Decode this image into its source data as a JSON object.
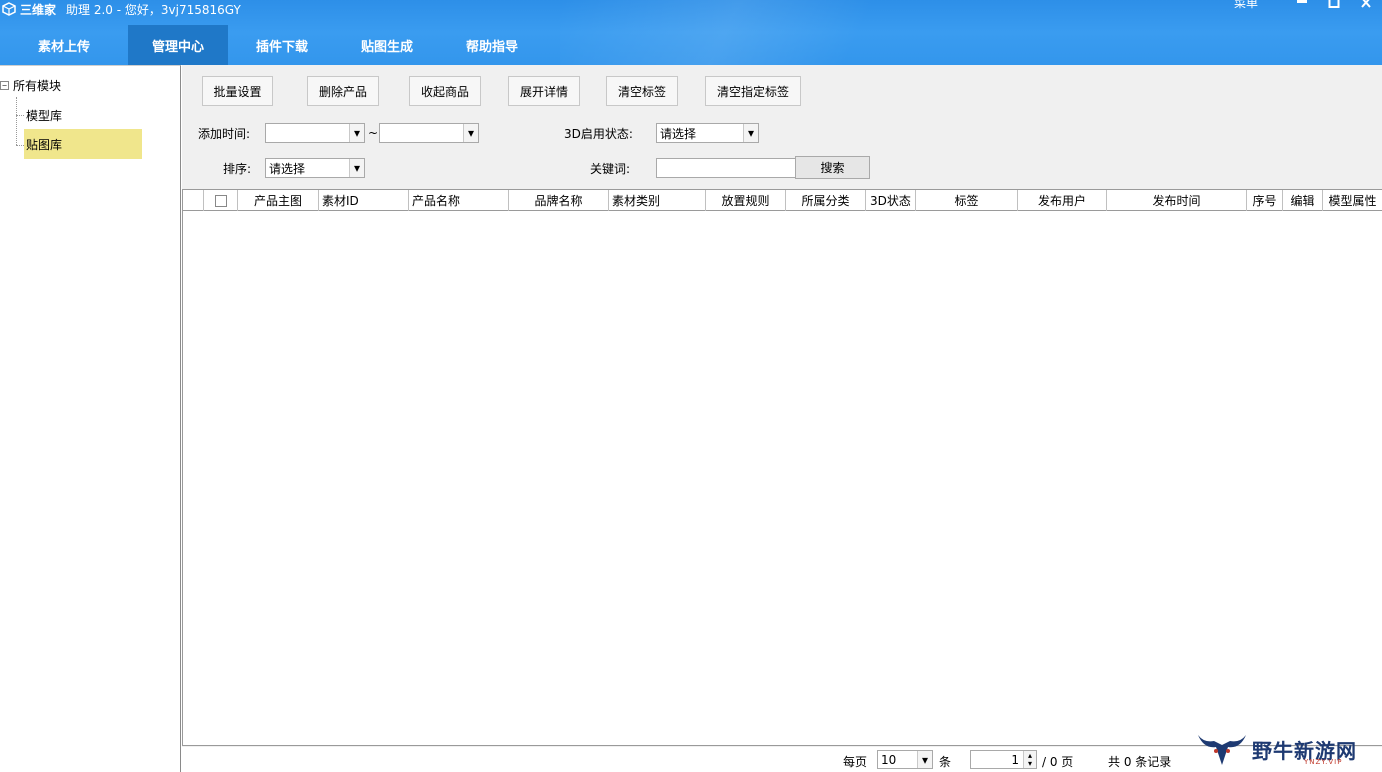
{
  "window": {
    "app_name": "三维家",
    "subtitle": "助理 2.0 - 您好，3vj715816GY",
    "menu_label": "菜单",
    "min_glyph": "▁",
    "max_glyph": "□",
    "close_glyph": "✕"
  },
  "tabs": [
    {
      "label": "素材上传"
    },
    {
      "label": "管理中心",
      "active": true
    },
    {
      "label": "插件下载"
    },
    {
      "label": "贴图生成"
    },
    {
      "label": "帮助指导"
    }
  ],
  "tree": {
    "toggle_glyph": "−",
    "root_label": "所有模块",
    "items": [
      {
        "label": "模型库"
      },
      {
        "label": "贴图库",
        "selected": true
      }
    ]
  },
  "toolbar": {
    "buttons": [
      {
        "label": "批量设置"
      },
      {
        "label": "删除产品"
      },
      {
        "label": "收起商品"
      },
      {
        "label": "展开详情"
      },
      {
        "label": "清空标签"
      },
      {
        "label": "清空指定标签"
      }
    ]
  },
  "filters": {
    "add_time_label": "添加时间:",
    "range_sep": "~",
    "date_from": "",
    "date_to": "",
    "state3d_label": "3D启用状态:",
    "state3d_value": "请选择",
    "sort_label": "排序:",
    "sort_value": "请选择",
    "keyword_label": "关键词:",
    "keyword_value": "",
    "search_label": "搜索",
    "dropdown_glyph": "▾"
  },
  "grid": {
    "columns": [
      {
        "label": ""
      },
      {
        "label": ""
      },
      {
        "label": "产品主图"
      },
      {
        "label": "素材ID"
      },
      {
        "label": "产品名称"
      },
      {
        "label": "品牌名称"
      },
      {
        "label": "素材类别"
      },
      {
        "label": "放置规则"
      },
      {
        "label": "所属分类"
      },
      {
        "label": "3D状态"
      },
      {
        "label": "标签"
      },
      {
        "label": "发布用户"
      },
      {
        "label": "发布时间"
      },
      {
        "label": "序号"
      },
      {
        "label": "编辑"
      },
      {
        "label": "模型属性"
      }
    ],
    "rows": []
  },
  "pager": {
    "per_page_label": "每页",
    "per_page_value": "10",
    "unit_label": "条",
    "page_value": "1",
    "page_total": "/ 0 页",
    "records_label": "共 0 条记录",
    "spin_up": "▴",
    "spin_down": "▾"
  },
  "watermark": {
    "text": "野牛新游网",
    "sub": "YNZY.VIP"
  },
  "colors": {
    "header": "#3396ec",
    "active_tab": "#1f78c8",
    "selected_tree": "#f0e68c"
  }
}
